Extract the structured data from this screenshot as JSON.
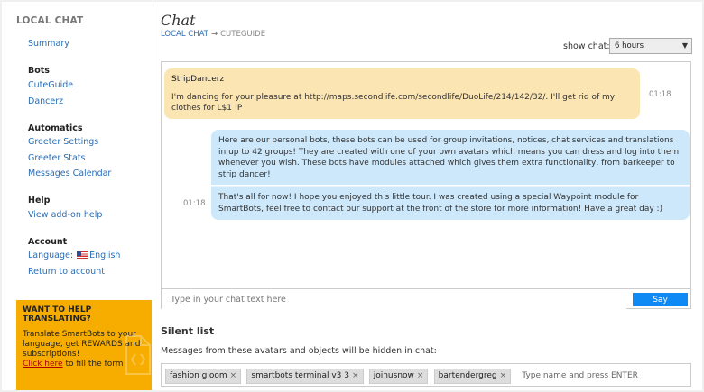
{
  "sidebar": {
    "app_title": "LOCAL CHAT",
    "summary": "Summary",
    "sections": {
      "bots": {
        "title": "Bots",
        "items": [
          "CuteGuide",
          "Dancerz"
        ]
      },
      "automatics": {
        "title": "Automatics",
        "items": [
          "Greeter Settings",
          "Greeter Stats",
          "Messages Calendar"
        ]
      },
      "help": {
        "title": "Help",
        "items": [
          "View add-on help"
        ]
      },
      "account": {
        "title": "Account",
        "language_label": "Language:",
        "language_value": "English",
        "return": "Return to account"
      }
    },
    "translate_box": {
      "title": "WANT TO HELP TRANSLATING?",
      "text": "Translate SmartBots to your language, get REWARDS and subscriptions!",
      "link": "Click here",
      "link_suffix": "to fill the form"
    }
  },
  "main": {
    "title": "Chat",
    "breadcrumb": {
      "parent": "LOCAL CHAT",
      "arrow": "→",
      "current": "CUTEGUIDE"
    },
    "show_chat": {
      "label": "show chat:",
      "value": "6 hours"
    },
    "messages": [
      {
        "sender": "StripDancerz",
        "text": "I'm dancing for your pleasure at http://maps.secondlife.com/secondlife/DuoLife/214/142/32/. I'll get rid of my clothes for L$1 :P",
        "time": "01:18"
      },
      {
        "text": "Here are our personal bots, these bots can be used for group invitations, notices, chat services and translations in up to 42 groups! They are created with one of your own avatars which means you can dress and log into them whenever you wish. These bots have modules attached which gives them extra functionality, from barkeeper to strip dancer!"
      },
      {
        "text": "That's all for now! I hope you enjoyed this little tour. I was created using a special Waypoint module for SmartBots, feel free to contact our support at the front of the store for more information! Have a great day :)",
        "time": "01:18"
      }
    ],
    "chat_input": {
      "placeholder": "Type in your chat text here",
      "button": "Say"
    },
    "silent_list": {
      "title": "Silent list",
      "description": "Messages from these avatars and objects will be hidden in chat:",
      "tags": [
        "fashion gloom",
        "smartbots terminal v3 3",
        "joinusnow",
        "bartendergreg"
      ],
      "remove_glyph": "×",
      "input_placeholder": "Type name and press ENTER"
    }
  },
  "colors": {
    "link": "#2a6db5",
    "accent_button": "#0f8af5",
    "help_box": "#f7ad00",
    "bubble_incoming": "#fbe5b3",
    "bubble_outgoing": "#cde8fb"
  }
}
